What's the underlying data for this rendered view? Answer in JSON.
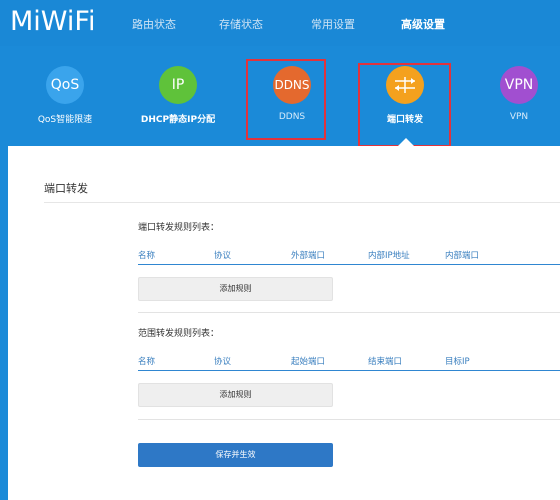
{
  "header": {
    "logo": "MiWiFi",
    "nav": [
      "路由状态",
      "存储状态",
      "常用设置",
      "高级设置"
    ],
    "active_nav": "高级设置"
  },
  "apps": [
    {
      "icon_text": "QoS",
      "label": "QoS智能限速",
      "color": "#3aa4ec",
      "icon": "qos-icon"
    },
    {
      "icon_text": "IP",
      "label": "DHCP静态IP分配",
      "color": "#5fc23a",
      "icon": "ip-icon"
    },
    {
      "icon_text": "DDNS",
      "label": "DDNS",
      "color": "#e4692e",
      "icon": "ddns-icon"
    },
    {
      "icon_text": "",
      "label": "端口转发",
      "color": "#f4a11e",
      "icon": "port-forward-icon"
    },
    {
      "icon_text": "VPN",
      "label": "VPN",
      "color": "#a14fd0",
      "icon": "vpn-icon"
    }
  ],
  "page": {
    "title": "端口转发",
    "rule_list": {
      "label": "端口转发规则列表：",
      "columns": [
        "名称",
        "协议",
        "外部端口",
        "内部IP地址",
        "内部端口"
      ],
      "add_label": "添加规则"
    },
    "range_list": {
      "label": "范围转发规则列表：",
      "columns": [
        "名称",
        "协议",
        "起始端口",
        "结束端口",
        "目标IP"
      ],
      "add_label": "添加规则"
    },
    "save_label": "保存并生效"
  }
}
